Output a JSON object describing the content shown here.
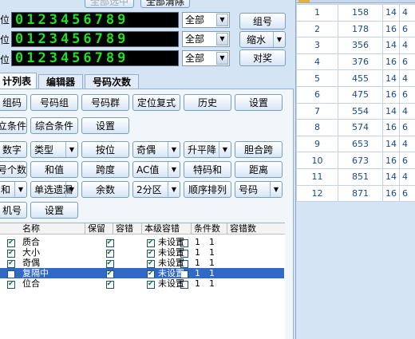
{
  "top_buttons": {
    "select_all": "全部选中",
    "clear_all": "全部清除"
  },
  "digit_rows": [
    {
      "label": "位",
      "digits": "0123456789",
      "combo": "全部"
    },
    {
      "label": "位",
      "digits": "0123456789",
      "combo": "全部"
    },
    {
      "label": "位",
      "digits": "0123456789",
      "combo": "全部"
    }
  ],
  "right_buttons": {
    "group": "组号",
    "shrink": "缩水",
    "prize": "对奖"
  },
  "tabs": [
    "计列表",
    "编辑器",
    "号码次数"
  ],
  "toolbar_rows": [
    [
      "组码",
      "号码组",
      "号码群",
      "定位复式",
      "历史",
      "设置"
    ],
    [
      "立条件",
      "综合条件",
      "设置"
    ],
    [
      "数字",
      "类型",
      "按位",
      "奇偶",
      "升平降",
      "胆合跨"
    ],
    [
      "号个数",
      "和值",
      "跨度",
      "AC值",
      "特码和",
      "距离"
    ],
    [
      "和",
      "单选遗漏",
      "余数",
      "2分区",
      "顺序排列",
      "号码"
    ],
    [
      "机号",
      "设置"
    ]
  ],
  "list_headers": {
    "name": "名称",
    "keep": "保留",
    "tolerance": "容错",
    "level_tolerance": "本级容错",
    "cond_count": "条件数",
    "err_count": "容错数"
  },
  "list_rows": [
    {
      "name": "质合",
      "level": "未设置",
      "cond": "1",
      "err": "1",
      "selected": false
    },
    {
      "name": "大小",
      "level": "未设置",
      "cond": "1",
      "err": "1",
      "selected": false
    },
    {
      "name": "奇偶",
      "level": "未设置",
      "cond": "1",
      "err": "1",
      "selected": false
    },
    {
      "name": "复隔中",
      "level": "未设置",
      "cond": "1",
      "err": "1",
      "selected": true
    },
    {
      "name": "位合",
      "level": "未设置",
      "cond": "1",
      "err": "1",
      "selected": false
    }
  ],
  "results": [
    {
      "no": "1",
      "value": "158",
      "a": "14",
      "b": "4"
    },
    {
      "no": "2",
      "value": "178",
      "a": "16",
      "b": "6"
    },
    {
      "no": "3",
      "value": "356",
      "a": "14",
      "b": "4"
    },
    {
      "no": "4",
      "value": "376",
      "a": "16",
      "b": "6"
    },
    {
      "no": "5",
      "value": "455",
      "a": "14",
      "b": "4"
    },
    {
      "no": "6",
      "value": "475",
      "a": "16",
      "b": "6"
    },
    {
      "no": "7",
      "value": "554",
      "a": "14",
      "b": "4"
    },
    {
      "no": "8",
      "value": "574",
      "b": "6",
      "a": "16"
    },
    {
      "no": "9",
      "value": "653",
      "a": "14",
      "b": "4"
    },
    {
      "no": "10",
      "value": "673",
      "a": "16",
      "b": "6"
    },
    {
      "no": "11",
      "value": "851",
      "a": "14",
      "b": "4"
    },
    {
      "no": "12",
      "value": "871",
      "a": "16",
      "b": "6"
    }
  ]
}
